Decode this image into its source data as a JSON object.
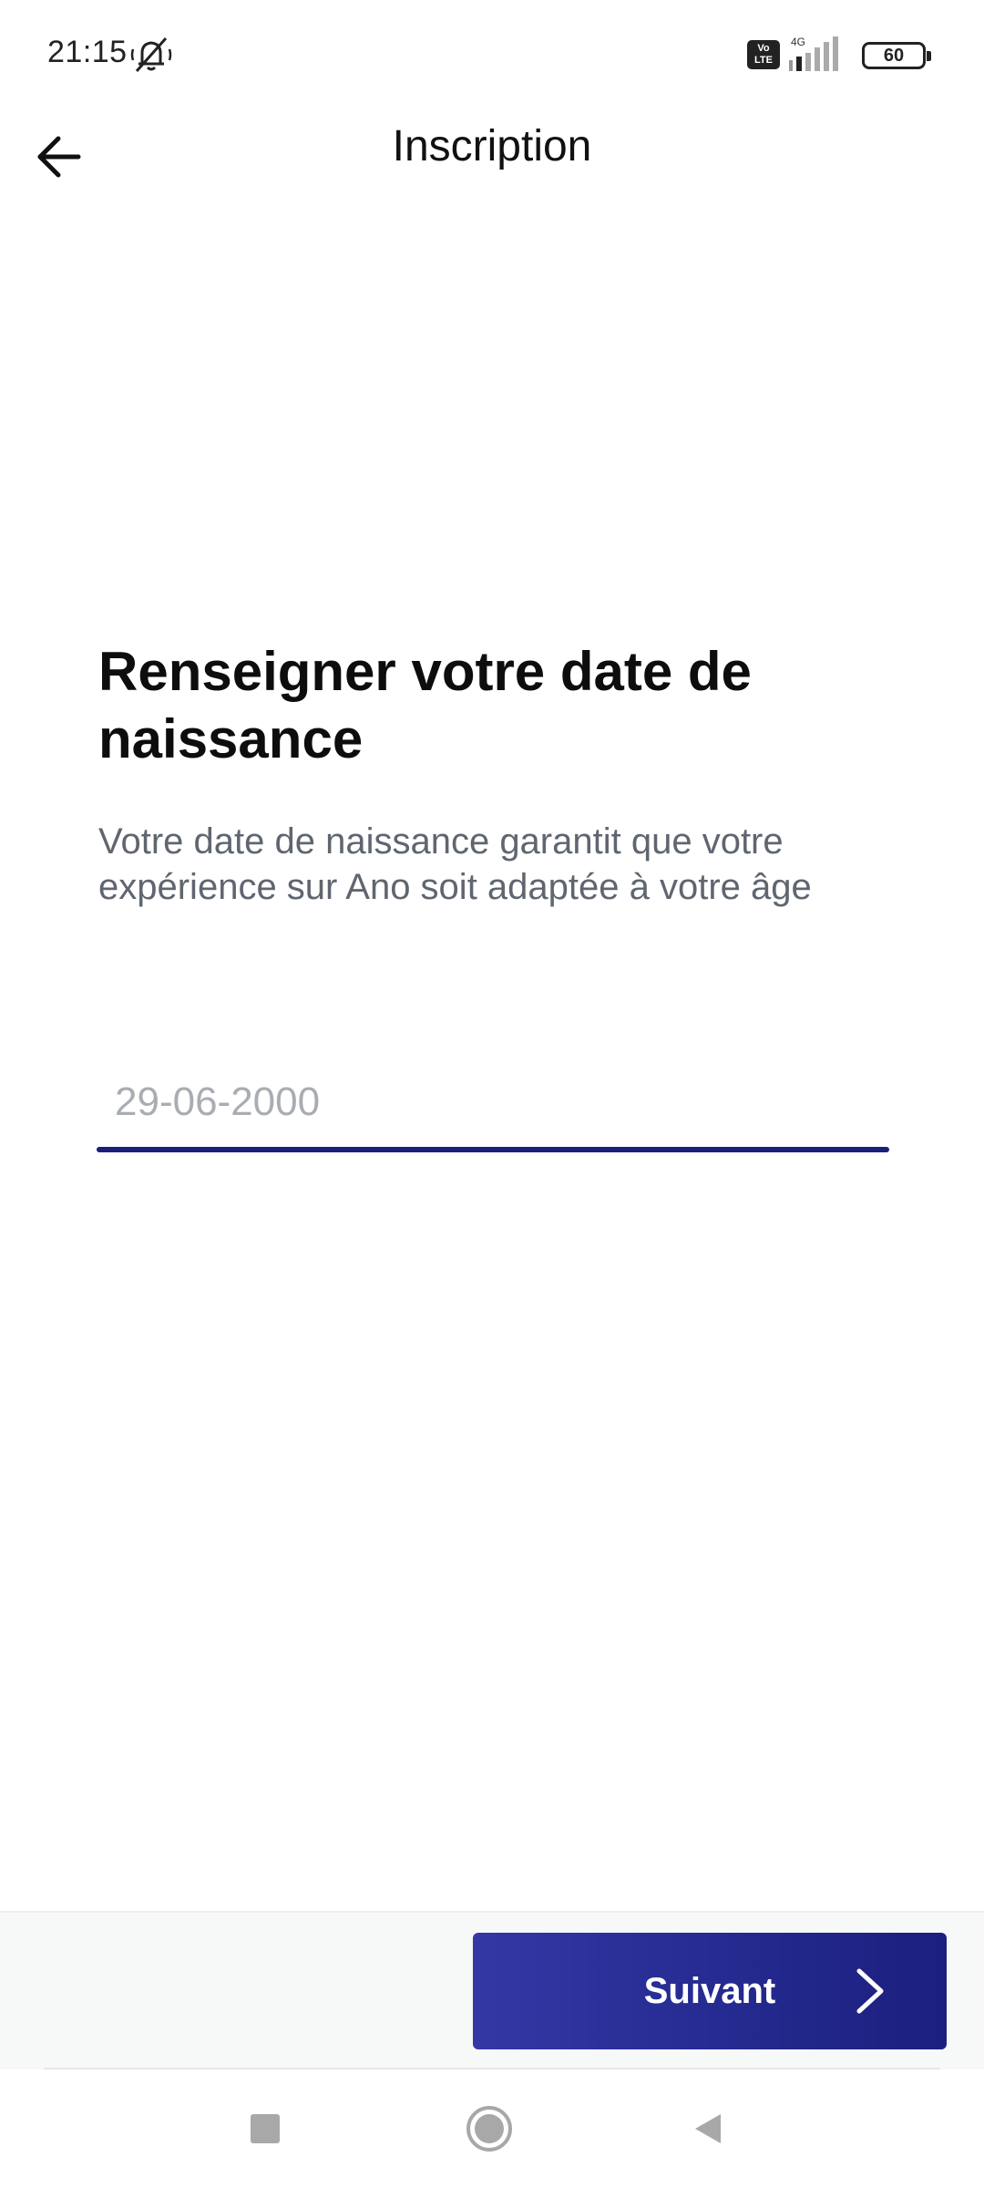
{
  "status_bar": {
    "time": "21:15",
    "volte": "Vo LTE",
    "network": "4G",
    "battery": "60"
  },
  "app_bar": {
    "title": "Inscription"
  },
  "content": {
    "heading": "Renseigner votre date de naissance",
    "description": "Votre date de naissance garantit que votre expérience sur Ano soit adaptée à votre âge",
    "date_input": {
      "value": "",
      "placeholder": "29-06-2000"
    }
  },
  "footer": {
    "next_label": "Suivant"
  },
  "colors": {
    "accent": "#1a1f7a",
    "button_gradient_start": "#3438a5",
    "button_gradient_end": "#1b1f7e",
    "description_text": "#5f6670",
    "placeholder_text": "#a9adb3"
  },
  "icons": {
    "back": "arrow-left-icon",
    "mute": "bell-off-icon",
    "next": "chevron-right-icon",
    "nav_recents": "square-icon",
    "nav_home": "circle-icon",
    "nav_back": "triangle-left-icon"
  }
}
